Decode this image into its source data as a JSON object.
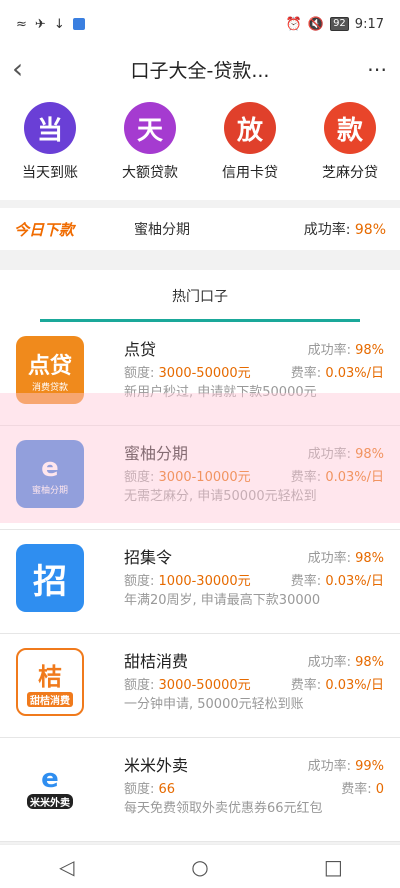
{
  "status": {
    "time": "9:17",
    "battery": "92",
    "icons_left": [
      "wifi-icon",
      "airplane-icon",
      "download-icon",
      "app-icon"
    ],
    "icons_right": [
      "alarm-icon",
      "mute-icon"
    ]
  },
  "appbar": {
    "title": "口子大全-贷款...",
    "back_icon": "chevron-left-icon",
    "more_icon": "more-icon"
  },
  "quick": [
    {
      "char": "当",
      "label": "当天到账",
      "color": "#6a3fd6"
    },
    {
      "char": "天",
      "label": "大额贷款",
      "color": "#a53bd0"
    },
    {
      "char": "放",
      "label": "信用卡贷",
      "color": "#e0402b"
    },
    {
      "char": "款",
      "label": "芝麻分贷",
      "color": "#e8452a"
    }
  ],
  "today": {
    "logo": "今日下款",
    "name": "蜜柚分期",
    "rate_label": "成功率:",
    "rate_value": "98%"
  },
  "hot": {
    "label": "热门口子"
  },
  "items": [
    {
      "name": "点贷",
      "rate_label": "成功率:",
      "rate": "98%",
      "amount_label": "额度:",
      "amount": "3000-50000元",
      "fee_label": "费率:",
      "fee": "0.03%/日",
      "desc": "新用户秒过, 申请就下款50000元",
      "logo_text": "点贷",
      "logo_sub": "消费贷款",
      "logo_color": "#f08a1c"
    },
    {
      "name": "蜜柚分期",
      "rate_label": "成功率:",
      "rate": "98%",
      "amount_label": "额度:",
      "amount": "3000-10000元",
      "fee_label": "费率:",
      "fee": "0.03%/日",
      "desc": "无需芝麻分, 申请50000元轻松到",
      "logo_text": "e",
      "logo_sub": "蜜柚分期",
      "logo_color": "#3a7fe0"
    },
    {
      "name": "招集令",
      "rate_label": "成功率:",
      "rate": "98%",
      "amount_label": "额度:",
      "amount": "1000-30000元",
      "fee_label": "费率:",
      "fee": "0.03%/日",
      "desc": "年满20周岁, 申请最高下款30000",
      "logo_text": "招",
      "logo_sub": "",
      "logo_color": "#2f8ef0"
    },
    {
      "name": "甜桔消费",
      "rate_label": "成功率:",
      "rate": "98%",
      "amount_label": "额度:",
      "amount": "3000-50000元",
      "fee_label": "费率:",
      "fee": "0.03%/日",
      "desc": "一分钟申请, 50000元轻松到账",
      "logo_text": "桔",
      "logo_sub": "甜桔消费",
      "logo_color": "#f07a1c"
    },
    {
      "name": "米米外卖",
      "rate_label": "成功率:",
      "rate": "99%",
      "amount_label": "额度:",
      "amount": "66",
      "fee_label": "费率:",
      "fee": "0",
      "desc": "每天免费领取外卖优惠券66元红包",
      "logo_text": "e",
      "logo_sub": "米米外卖",
      "logo_color": "#f5b400"
    }
  ],
  "nav": {
    "back_icon": "nav-back-icon",
    "home_icon": "nav-home-icon",
    "recent_icon": "nav-recent-icon"
  }
}
